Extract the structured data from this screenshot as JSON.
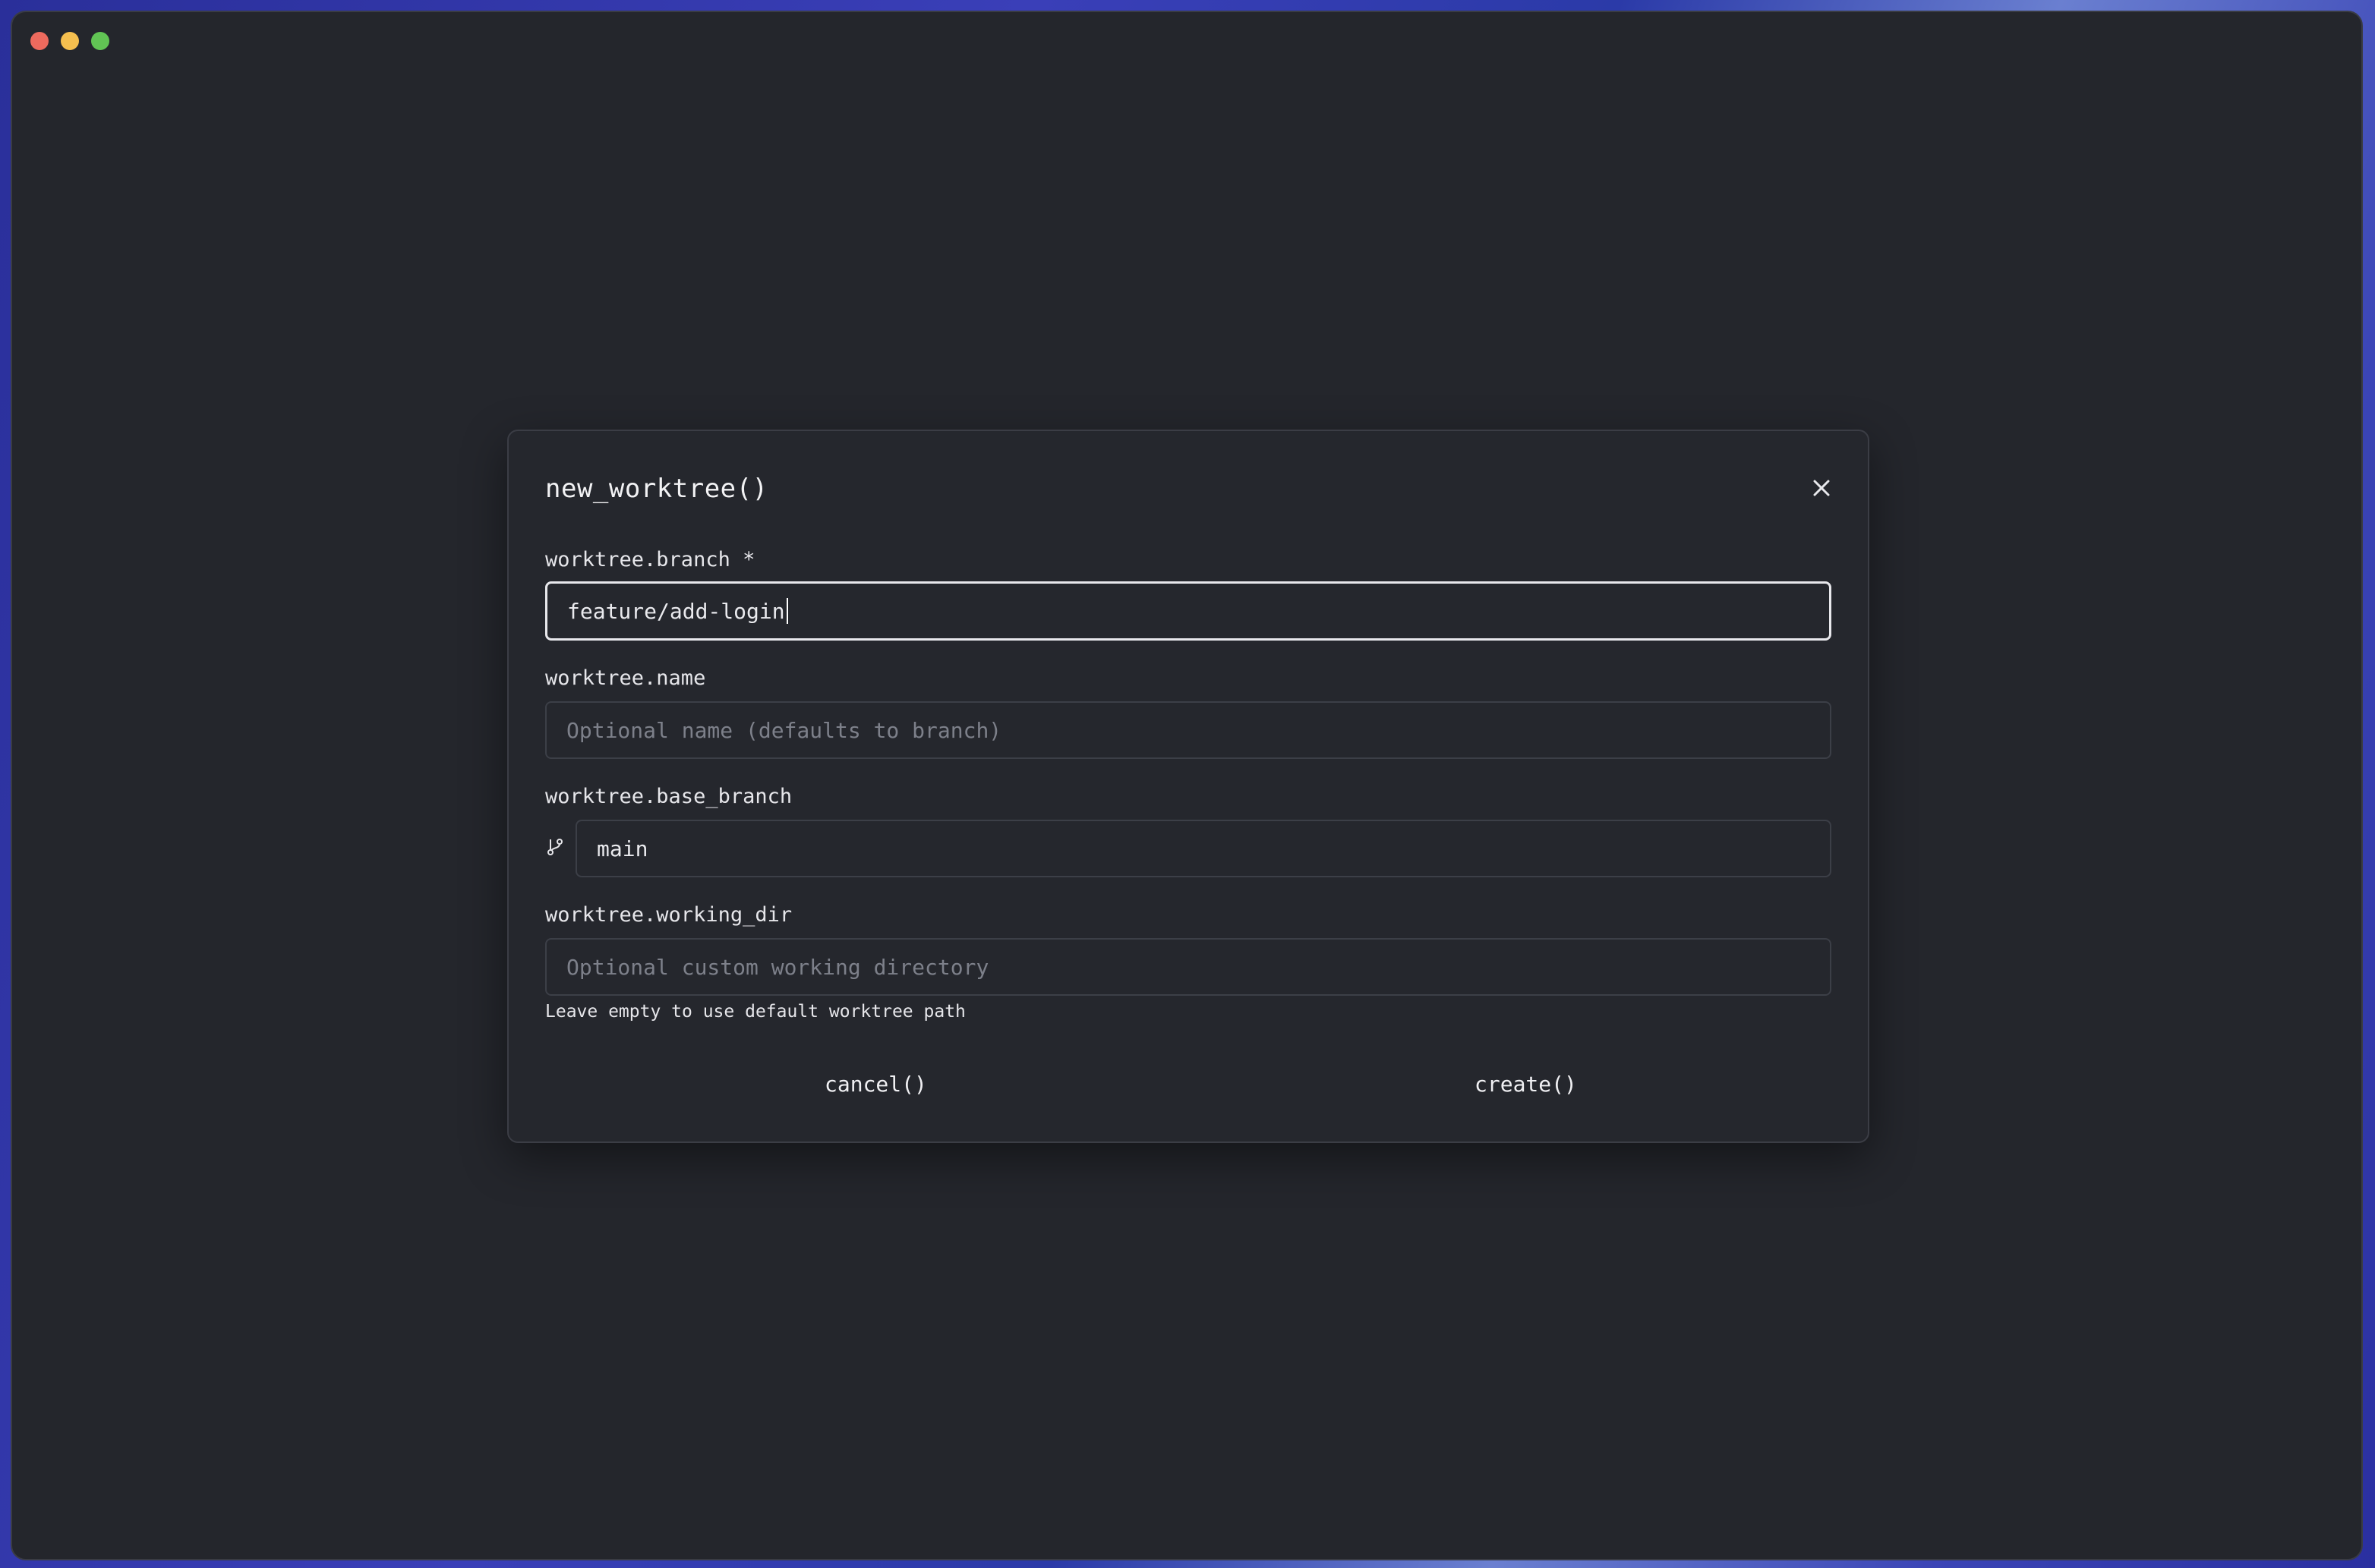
{
  "window": {
    "traffic_lights": [
      "close",
      "minimize",
      "zoom"
    ]
  },
  "dialog": {
    "title": "new_worktree()",
    "close_icon": "close-icon",
    "fields": {
      "branch": {
        "label": "worktree.branch *",
        "value": "feature/add-login",
        "placeholder": ""
      },
      "name": {
        "label": "worktree.name",
        "value": "",
        "placeholder": "Optional name (defaults to branch)"
      },
      "base_branch": {
        "label": "worktree.base_branch",
        "icon": "git-branch-icon",
        "value": "main"
      },
      "working_dir": {
        "label": "worktree.working_dir",
        "value": "",
        "placeholder": "Optional custom working directory",
        "hint": "Leave empty to use default worktree path"
      }
    },
    "buttons": {
      "cancel": "cancel()",
      "create": "create()"
    }
  }
}
